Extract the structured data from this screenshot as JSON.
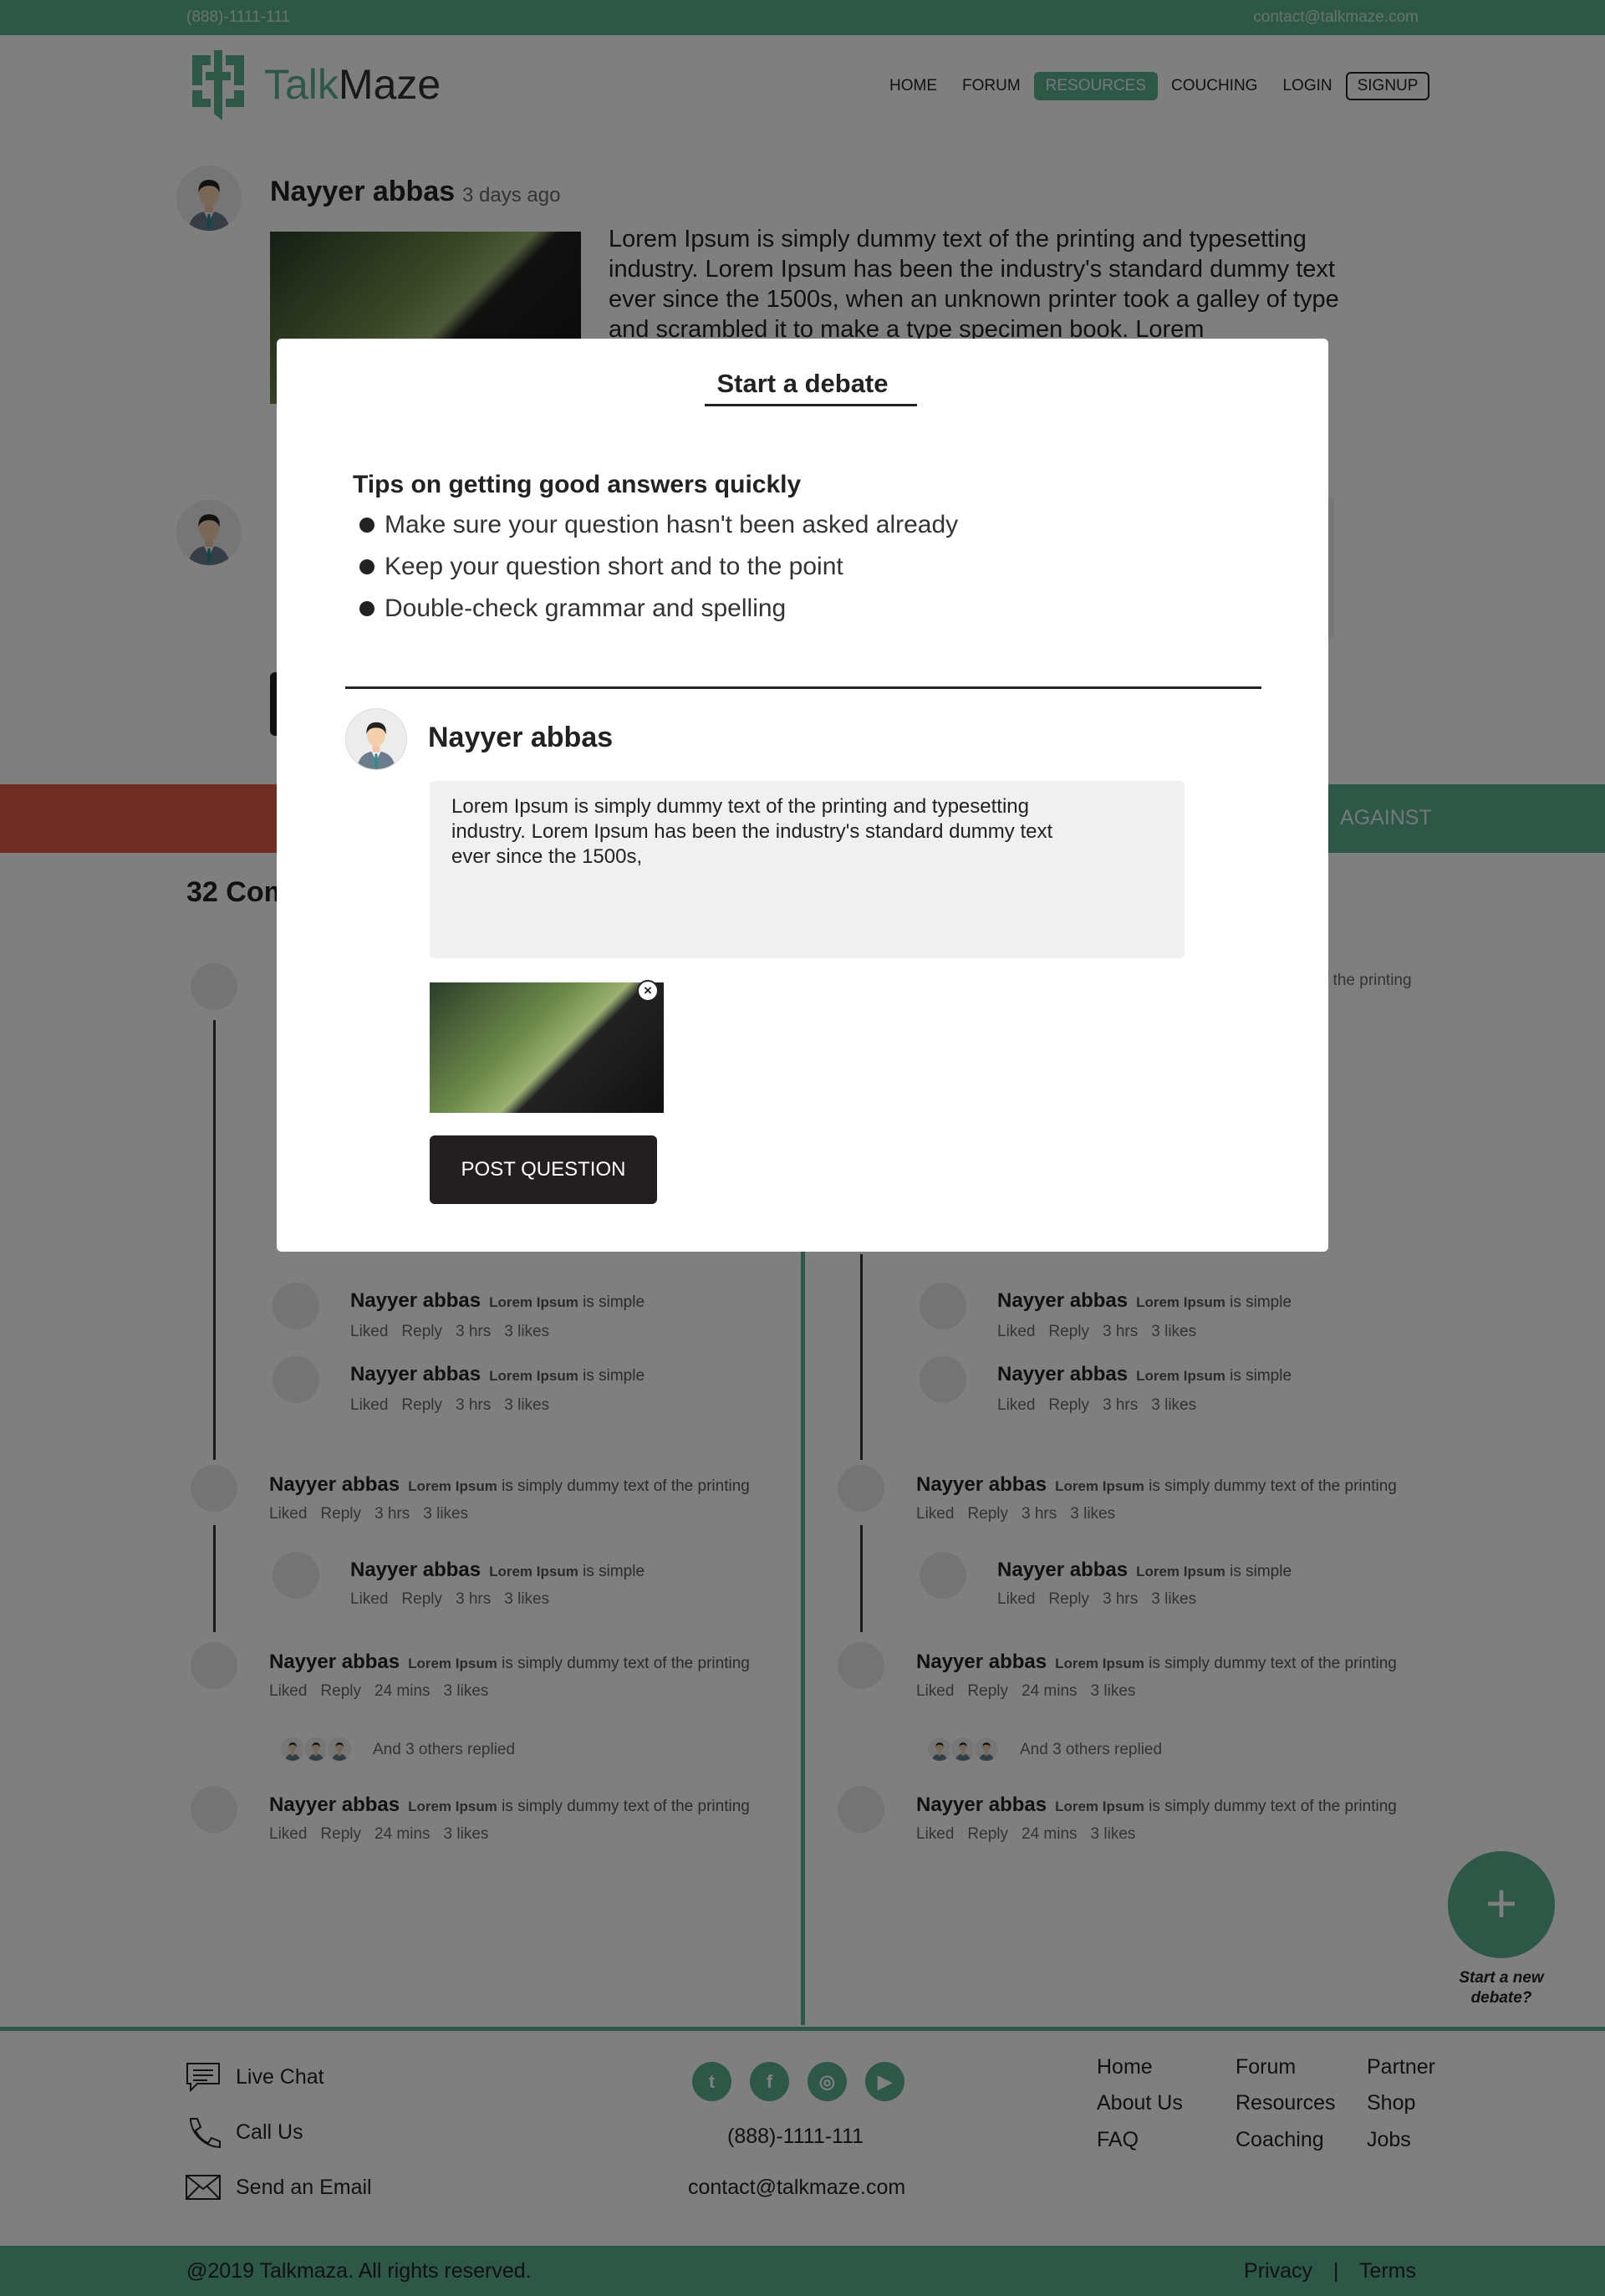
{
  "topbar": {
    "phone": "(888)-1111-111",
    "email": "contact@talkmaze.com"
  },
  "brand": {
    "part1": "Talk",
    "part2": "Maze"
  },
  "nav": {
    "home": "HOME",
    "forum": "FORUM",
    "resources": "RESOURCES",
    "couching": "COUCHING",
    "login": "LOGIN",
    "signup": "SIGNUP"
  },
  "post": {
    "author": "Nayyer abbas",
    "time": "3 days ago",
    "text": "Lorem Ipsum is simply dummy text of the printing and typesetting industry. Lorem Ipsum has been the industry's standard dummy text ever since the 1500s, when an unknown printer took a galley of type and scrambled it to make a type specimen book. Lorem"
  },
  "sides": {
    "against": "AGAINST"
  },
  "comments": {
    "title": "32 Com",
    "items": [
      {
        "author": "Nayyer abbas",
        "bold": "Lorem Ipsum",
        "text": "is simple",
        "meta": [
          "Liked",
          "Reply",
          "3 hrs",
          "3 likes"
        ]
      },
      {
        "author": "Nayyer abbas",
        "bold": "Lorem Ipsum",
        "text": "is simply dummy text of the printing",
        "meta": [
          "Liked",
          "Reply",
          "3 hrs",
          "3 likes"
        ]
      },
      {
        "author": "Nayyer abbas",
        "bold": "Lorem Ipsum",
        "text": "is simply dummy text of the printing",
        "meta": [
          "Liked",
          "Reply",
          "24 mins",
          "3 likes"
        ]
      }
    ],
    "others_replied": "And 3 others replied",
    "partial_right": "f the printing"
  },
  "fab": {
    "icon": "+",
    "label": "Start a new debate?"
  },
  "footer": {
    "live_chat": "Live Chat",
    "call_us": "Call Us",
    "send_email": "Send an Email",
    "phone": "(888)-1111-111",
    "email": "contact@talkmaze.com",
    "social": [
      "twitter-icon",
      "facebook-icon",
      "instagram-icon",
      "youtube-icon"
    ],
    "links": {
      "col1": [
        "Home",
        "About Us",
        "FAQ"
      ],
      "col2": [
        "Forum",
        "Resources",
        "Coaching"
      ],
      "col3": [
        "Partner",
        "Shop",
        "Jobs"
      ]
    },
    "copyright": "@2019 Talkmaza. All rights reserved.",
    "privacy": "Privacy",
    "separator": "|",
    "terms": "Terms"
  },
  "modal": {
    "title": "Start a debate",
    "tips_title": "Tips on getting good answers quickly",
    "tips": [
      "Make sure your question hasn't been asked already",
      "Keep your question short and to the point",
      "Double-check grammar and spelling"
    ],
    "author": "Nayyer abbas",
    "question_text": "Lorem Ipsum is simply dummy text of the printing and typesetting industry. Lorem Ipsum has been the industry's standard dummy text ever since the 1500s,",
    "close_icon": "×",
    "post_button": "POST QUESTION"
  },
  "colors": {
    "accent": "#5aaf8d",
    "for": "#e05a4c",
    "button": "#231f20"
  }
}
